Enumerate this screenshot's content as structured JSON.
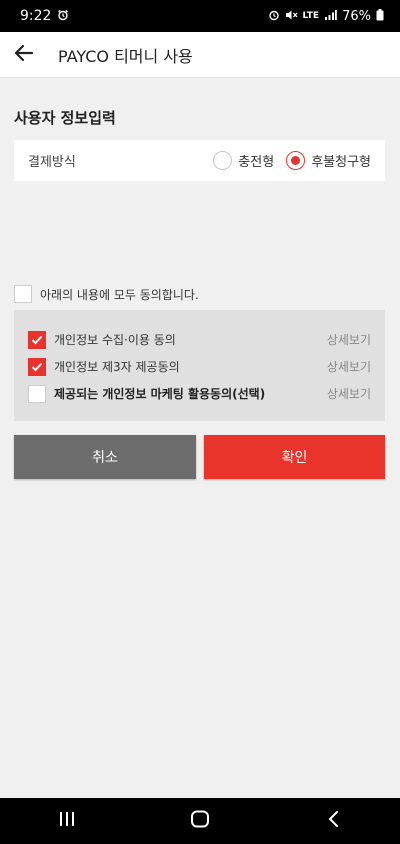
{
  "status_bar": {
    "time": "9:22",
    "network": "LTE",
    "battery": "76%"
  },
  "header": {
    "title": "PAYCO 티머니 사용"
  },
  "form": {
    "section_title": "사용자 정보입력",
    "payment_label": "결제방식",
    "options": [
      {
        "label": "충전형",
        "selected": false
      },
      {
        "label": "후불청구형",
        "selected": true
      }
    ]
  },
  "agreements": {
    "agree_all_label": "아래의 내용에 모두 동의합니다.",
    "agree_all_checked": false,
    "items": [
      {
        "label": "개인정보 수집·이용 동의",
        "checked": true,
        "detail": "상세보기"
      },
      {
        "label": "개인정보 제3자 제공동의",
        "checked": true,
        "detail": "상세보기"
      },
      {
        "label": "제공되는 개인정보 마케팅 활용동의(선택)",
        "checked": false,
        "detail": "상세보기"
      }
    ]
  },
  "buttons": {
    "cancel": "취소",
    "confirm": "확인"
  },
  "colors": {
    "accent": "#e8322b",
    "cancel_bg": "#6d6d6d"
  }
}
